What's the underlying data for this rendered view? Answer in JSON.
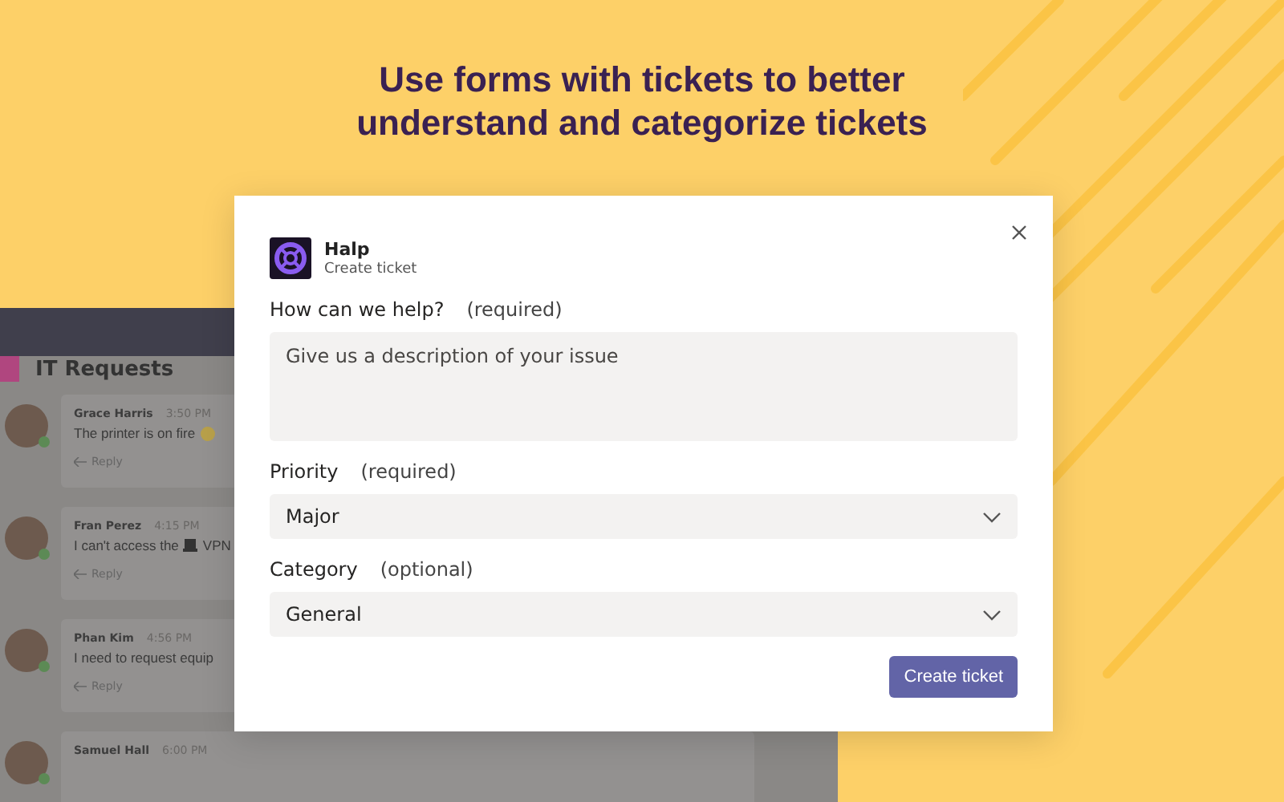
{
  "headline": "Use forms with tickets to better understand and categorize tickets",
  "back_window": {
    "channel": {
      "title": "IT Requests"
    },
    "messages": [
      {
        "author": "Grace Harris",
        "time": "3:50 PM",
        "kind": "emoji",
        "text": "The printer is on fire",
        "reply": "Reply"
      },
      {
        "author": "Fran Perez",
        "time": "4:15 PM",
        "kind": "laptop",
        "text": "I can't access the",
        "text_after": "VPN",
        "reply": "Reply"
      },
      {
        "author": "Phan Kim",
        "time": "4:56 PM",
        "kind": "plain",
        "text": "I need to request equip",
        "reply": "Reply"
      },
      {
        "author": "Samuel Hall",
        "time": "6:00 PM"
      }
    ]
  },
  "dialog": {
    "app": {
      "name": "Halp",
      "subtitle": "Create ticket"
    },
    "fields": [
      {
        "kind": "textarea",
        "label": "How can we help?",
        "note": "(required)",
        "placeholder": "Give us a description of your issue"
      },
      {
        "kind": "select",
        "label": "Priority",
        "note": "(required)",
        "value": "Major"
      },
      {
        "kind": "select",
        "label": "Category",
        "note": "(optional)",
        "value": "General"
      }
    ],
    "button": "Create ticket"
  }
}
